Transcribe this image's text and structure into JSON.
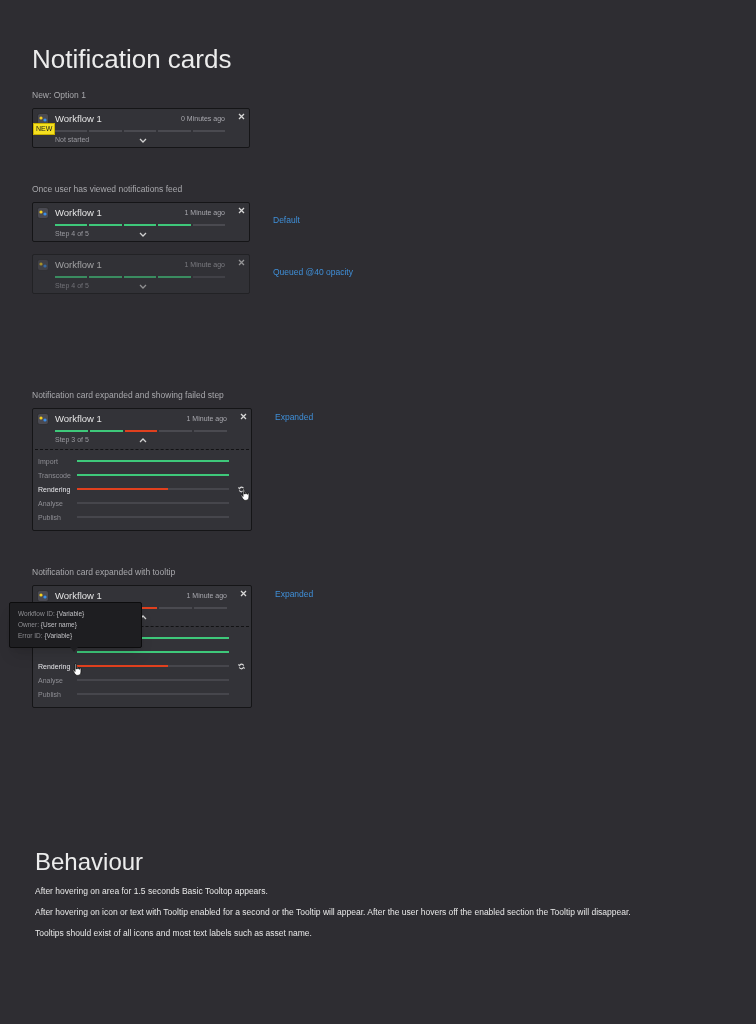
{
  "page_title": "Notification cards",
  "sections": [
    {
      "caption": "New: Option 1",
      "cards": [
        {
          "title": "Workflow 1",
          "time": "0 Minutes ago",
          "badge": "NEW",
          "dimmed": false,
          "expanded": false,
          "segments": [
            {
              "color": "#4a4a50"
            },
            {
              "color": "#4a4a50"
            },
            {
              "color": "#4a4a50"
            },
            {
              "color": "#4a4a50"
            },
            {
              "color": "#4a4a50"
            }
          ],
          "status": "Not started"
        }
      ]
    },
    {
      "caption": "Once user has viewed notifications feed",
      "cards": [
        {
          "title": "Workflow 1",
          "time": "1 Minute ago",
          "dimmed": false,
          "expanded": false,
          "segments": [
            {
              "color": "#3ec87a"
            },
            {
              "color": "#3ec87a"
            },
            {
              "color": "#3ec87a"
            },
            {
              "color": "#3ec87a"
            },
            {
              "color": "#4a4a50"
            }
          ],
          "status": "Step 4 of 5",
          "note": "Default"
        },
        {
          "title": "Workflow 1",
          "time": "1 Minute ago",
          "dimmed": true,
          "expanded": false,
          "segments": [
            {
              "color": "#3a8c60"
            },
            {
              "color": "#3a8c60"
            },
            {
              "color": "#3a8c60"
            },
            {
              "color": "#3a8c60"
            },
            {
              "color": "#414147"
            }
          ],
          "status": "Step 4 of 5",
          "note": "Queued @40 opacity"
        }
      ]
    },
    {
      "caption": "Notification card expanded and showing failed step",
      "cards": [
        {
          "title": "Workflow 1",
          "time": "1 Minute ago",
          "dimmed": false,
          "expanded": true,
          "segments": [
            {
              "color": "#3ec87a"
            },
            {
              "color": "#3ec87a"
            },
            {
              "color": "#e0401e"
            },
            {
              "color": "#4a4a50"
            },
            {
              "color": "#4a4a50"
            }
          ],
          "status": "Step 3 of 5",
          "note": "Expanded",
          "steps": [
            {
              "name": "Import",
              "color": "#3ec87a",
              "level": 1,
              "highlighted": false,
              "retry": false,
              "cursor": false
            },
            {
              "name": "Transcode",
              "color": "#3ec87a",
              "level": 1,
              "highlighted": false,
              "retry": false,
              "cursor": false
            },
            {
              "name": "Rendering",
              "color": "#e0401e",
              "level": 0.6,
              "highlighted": true,
              "retry": true,
              "cursor": true
            },
            {
              "name": "Analyse",
              "highlighted": false,
              "retry": false,
              "cursor": false
            },
            {
              "name": "Publish",
              "highlighted": false,
              "retry": false,
              "cursor": false
            }
          ]
        }
      ]
    },
    {
      "caption": "Notification card expanded with tooltip",
      "cards": [
        {
          "title": "Workflow 1",
          "time": "1 Minute ago",
          "dimmed": false,
          "expanded": true,
          "segments": [
            {
              "color": "#e0401e"
            },
            {
              "color": "#4a4a50"
            },
            {
              "color": "#4a4a50"
            }
          ],
          "note": "Expanded",
          "steps": [
            {
              "color": "#3ec87a",
              "level": 1,
              "retry": false
            },
            {
              "color": "#3ec87a",
              "level": 1,
              "retry": false
            },
            {
              "name": "Rendering",
              "color": "#e0401e",
              "level": 0.6,
              "highlighted": true,
              "retry": true,
              "cursor": true
            },
            {
              "name": "Analyse",
              "highlighted": false,
              "retry": false,
              "cursor": false
            },
            {
              "name": "Publish",
              "highlighted": false,
              "retry": false,
              "cursor": false
            }
          ],
          "tooltip": [
            {
              "label": "Workflow ID:",
              "value": "{Variable}"
            },
            {
              "label": "Owner:",
              "value": "{User name}"
            },
            {
              "label": "Error ID:",
              "value": "{Variable}"
            }
          ]
        }
      ]
    }
  ],
  "behaviour": {
    "title": "Behaviour",
    "paragraphs": [
      "After hovering on area  for 1.5 seconds Basic Tooltop appears.",
      "After hovering on icon or text with Tooltip enabled for a second or the Tooltip will appear. After the user hovers off the enabled section the Tooltip will disappear.",
      "Tooltips should exist of all icons and most text labels such as asset name."
    ]
  }
}
